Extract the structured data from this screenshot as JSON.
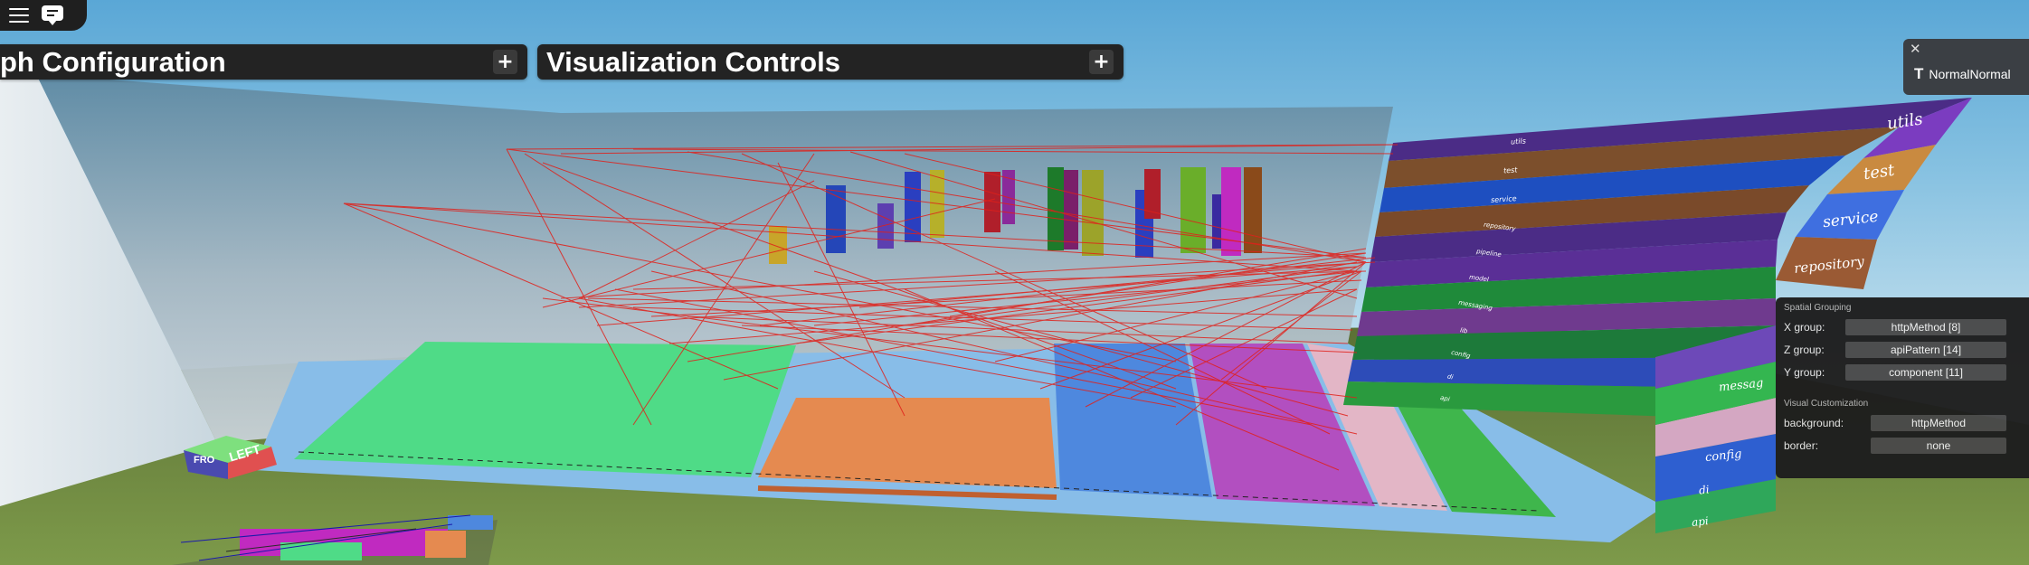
{
  "menu": {
    "menu_icon": "hamburger-icon",
    "chat_icon": "chat-icon"
  },
  "panels": {
    "graph_config": {
      "title": "ph Configuration",
      "toggle": "+"
    },
    "visualization": {
      "title": "Visualization Controls",
      "toggle": "+"
    }
  },
  "notification": {
    "close": "✕",
    "logo": "T",
    "text": "NormalNormal"
  },
  "spatial_grouping": {
    "heading": "Spatial Grouping",
    "x_label": "X group:",
    "x_value": "httpMethod [8]",
    "z_label": "Z group:",
    "z_value": "apiPattern [14]",
    "y_label": "Y group:",
    "y_value": "component [11]"
  },
  "visual_customization": {
    "heading": "Visual Customization",
    "background_label": "background:",
    "background_value": "httpMethod",
    "border_label": "border:",
    "border_value": "none"
  },
  "layer_labels_large": [
    "utils",
    "test",
    "service",
    "repository",
    "messag",
    "config",
    "di",
    "api"
  ],
  "layer_labels_small": [
    "utils",
    "test",
    "service",
    "repository",
    "pipeline",
    "model",
    "messaging",
    "lib",
    "config",
    "di",
    "api"
  ],
  "orientation_cube": {
    "front": "FRO",
    "left": "LEFT"
  }
}
